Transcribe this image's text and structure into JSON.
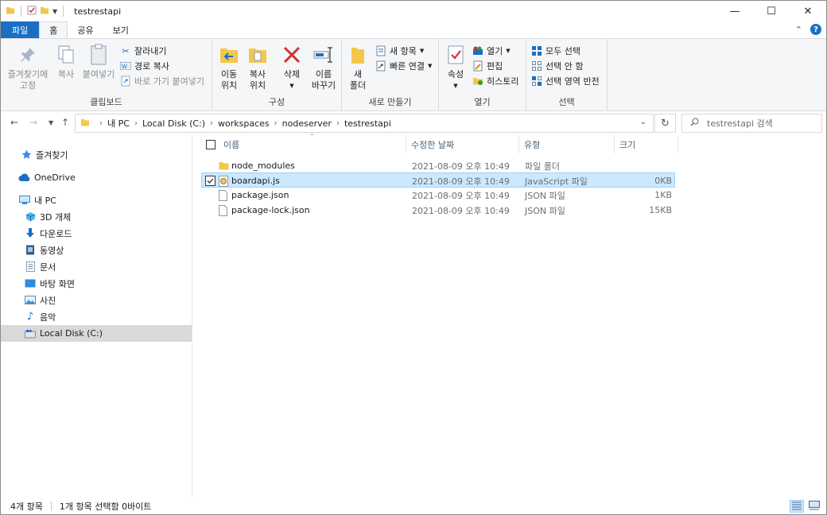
{
  "window": {
    "title": "testrestapi",
    "controls": {
      "minimize": "—",
      "maximize": "☐",
      "close": "✕"
    }
  },
  "ribbon_tabs": [
    {
      "label": "파일"
    },
    {
      "label": "홈"
    },
    {
      "label": "공유"
    },
    {
      "label": "보기"
    }
  ],
  "ribbon": {
    "clipboard": {
      "label": "클립보드",
      "pin_line1": "즐겨찾기에",
      "pin_line2": "고정",
      "copy": "복사",
      "paste": "붙여넣기",
      "cut": "잘라내기",
      "copy_path": "경로 복사",
      "paste_shortcut": "바로 가기 붙여넣기"
    },
    "organize": {
      "label": "구성",
      "move_line1": "이동",
      "move_line2": "위치",
      "copyto_line1": "복사",
      "copyto_line2": "위치",
      "delete": "삭제",
      "rename_line1": "이름",
      "rename_line2": "바꾸기"
    },
    "new": {
      "label": "새로 만들기",
      "folder_line1": "새",
      "folder_line2": "폴더",
      "new_item": "새 항목",
      "easy_access": "빠른 연결"
    },
    "open": {
      "label": "열기",
      "properties": "속성",
      "open": "열기",
      "edit": "편집",
      "history": "히스토리"
    },
    "select": {
      "label": "선택",
      "select_all": "모두 선택",
      "select_none": "선택 안 함",
      "invert": "선택 영역 반전"
    }
  },
  "address": {
    "crumbs": [
      "내 PC",
      "Local Disk (C:)",
      "workspaces",
      "nodeserver",
      "testrestapi"
    ],
    "search_placeholder": "testrestapi 검색"
  },
  "navpane": {
    "items": [
      {
        "label": "즐겨찾기",
        "icon": "star-icon"
      },
      {
        "label": "OneDrive",
        "icon": "cloud-icon"
      },
      {
        "label": "내 PC",
        "icon": "pc-icon"
      },
      {
        "label": "3D 개체",
        "icon": "cube-icon"
      },
      {
        "label": "다운로드",
        "icon": "download-icon"
      },
      {
        "label": "동영상",
        "icon": "video-icon"
      },
      {
        "label": "문서",
        "icon": "document-icon"
      },
      {
        "label": "바탕 화면",
        "icon": "desktop-icon"
      },
      {
        "label": "사진",
        "icon": "picture-icon"
      },
      {
        "label": "음악",
        "icon": "music-icon"
      },
      {
        "label": "Local Disk (C:)",
        "icon": "drive-icon"
      }
    ]
  },
  "columns": {
    "name": "이름",
    "modified": "수정한 날짜",
    "type": "유형",
    "size": "크기"
  },
  "files": [
    {
      "name": "node_modules",
      "modified": "2021-08-09 오후 10:49",
      "type": "파일 폴더",
      "size": "",
      "icon": "folder-icon"
    },
    {
      "name": "boardapi.js",
      "modified": "2021-08-09 오후 10:49",
      "type": "JavaScript 파일",
      "size": "0KB",
      "icon": "js-file-icon"
    },
    {
      "name": "package.json",
      "modified": "2021-08-09 오후 10:49",
      "type": "JSON 파일",
      "size": "1KB",
      "icon": "file-icon"
    },
    {
      "name": "package-lock.json",
      "modified": "2021-08-09 오후 10:49",
      "type": "JSON 파일",
      "size": "15KB",
      "icon": "file-icon"
    }
  ],
  "status": {
    "item_count": "4개 항목",
    "selection": "1개 항목 선택함 0바이트"
  },
  "colors": {
    "accent": "#1a6fc4",
    "selection_bg": "#cce8ff",
    "selection_border": "#99d1ff",
    "folder": "#f3c74b"
  }
}
